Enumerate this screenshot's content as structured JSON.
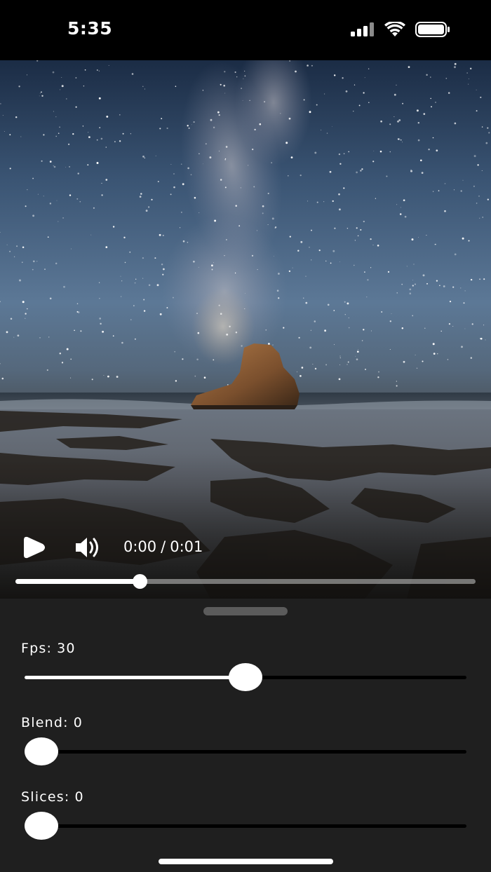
{
  "status_bar": {
    "time": "5:35",
    "icons": [
      "cellular-signal-icon",
      "wifi-icon",
      "battery-icon"
    ]
  },
  "player": {
    "play_icon": "play-icon",
    "volume_icon": "volume-icon",
    "current_time": "0:00",
    "separator": "/",
    "duration": "0:01",
    "progress": 0.27
  },
  "controls_panel": {
    "sliders": [
      {
        "id": "fps",
        "label": "Fps:",
        "value": "30",
        "fraction": 0.5
      },
      {
        "id": "blend",
        "label": "Blend:",
        "value": "0",
        "fraction": 0.0
      },
      {
        "id": "slices",
        "label": "Slices:",
        "value": "0",
        "fraction": 0.0
      }
    ]
  },
  "colors": {
    "background": "#000000",
    "sheet": "#1f1f1f",
    "accent": "#ffffff"
  }
}
